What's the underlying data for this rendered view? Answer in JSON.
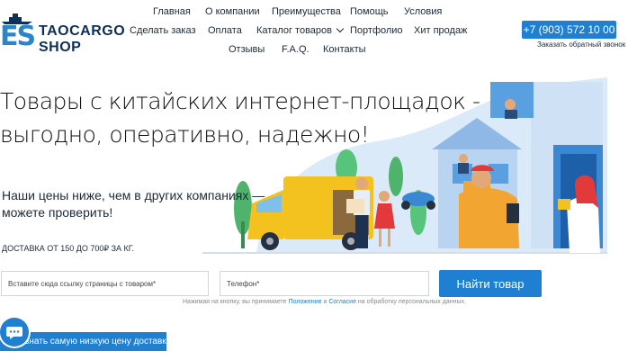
{
  "logo": {
    "mark": "ES",
    "line1": "TAOCARGO",
    "line2": "SHOP"
  },
  "nav": {
    "row1": [
      "Главная",
      "О компании",
      "Преимущества",
      "Помощь",
      "Условия"
    ],
    "row2": [
      "Сделать заказ",
      "Оплата",
      "Каталог товаров",
      "Портфолио",
      "Хит продаж"
    ],
    "row3": [
      "Отзывы",
      "F.A.Q.",
      "Контакты"
    ]
  },
  "header": {
    "phone": "+7 (903) 572 10 00",
    "callback": "Заказать обратный звонок"
  },
  "hero": {
    "title_line1": "Товары с китайских интернет-площадок -",
    "title_line2": "выгодно, оперативно, надежно!",
    "subtitle_line1": "Наши цены ниже, чем в других компаниях —",
    "subtitle_line2": "можете проверить!",
    "delivery": "ДОСТАВКА ОТ 150 ДО 700₽ ЗА КГ."
  },
  "form": {
    "link_placeholder": "Вставите сюда ссылку страницы с товаром*",
    "phone_placeholder": "Телефон*",
    "submit_label": "Найти товар",
    "consent_prefix": "Нажимая на кнопку, вы принимаете ",
    "consent_link1": "Положение",
    "consent_and": " и ",
    "consent_link2": "Согласие",
    "consent_suffix": " на обработку персональных данных."
  },
  "cta": {
    "lowest_price": "Узнать самую низкую цену доставки"
  },
  "icons": {
    "chat": "chat-icon",
    "ship": "ship-icon",
    "illustration": "delivery-illustration"
  },
  "colors": {
    "accent": "#1f7fd0",
    "logo_dark": "#0d2f58",
    "logo_light": "#2a86c8",
    "van": "#f4c21f",
    "courier": "#f2a531"
  }
}
